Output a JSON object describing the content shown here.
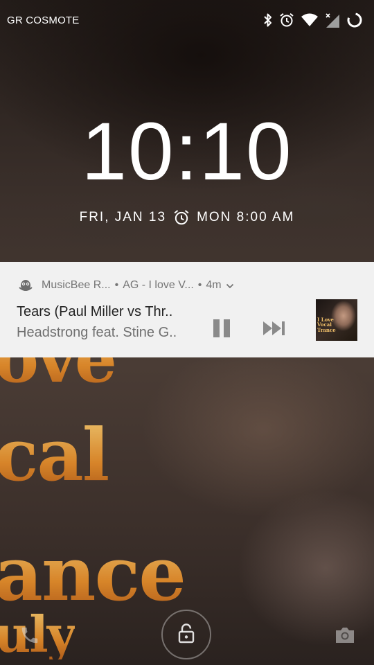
{
  "status_bar": {
    "carrier": "GR COSMOTE",
    "icons": [
      "bluetooth-icon",
      "alarm-icon",
      "wifi-icon",
      "signal-no-service-icon",
      "battery-charging-icon"
    ]
  },
  "lockscreen": {
    "time": "10:10",
    "date": "FRI, JAN 13",
    "next_alarm": "MON 8:00 AM"
  },
  "notification": {
    "app_name": "MusicBee R...",
    "subtext": "AG - I love V...",
    "time_ago": "4m",
    "title": "Tears (Paul Miller vs Thr..",
    "subtitle": "Headstrong feat. Stine G..",
    "actions": [
      "pause-icon",
      "skip-next-icon"
    ],
    "album_art_text": "I Love\nVocal\nTrance"
  },
  "wallpaper": {
    "text_lines": [
      "ove",
      "cal",
      "ance",
      "uly"
    ]
  },
  "bottom": {
    "left_shortcut": "phone-icon",
    "center": "unlock-icon",
    "right_shortcut": "camera-icon"
  },
  "colors": {
    "notification_bg": "#f1f1f1",
    "wallpaper_text": "#e39a3c",
    "clock": "#ffffff"
  }
}
